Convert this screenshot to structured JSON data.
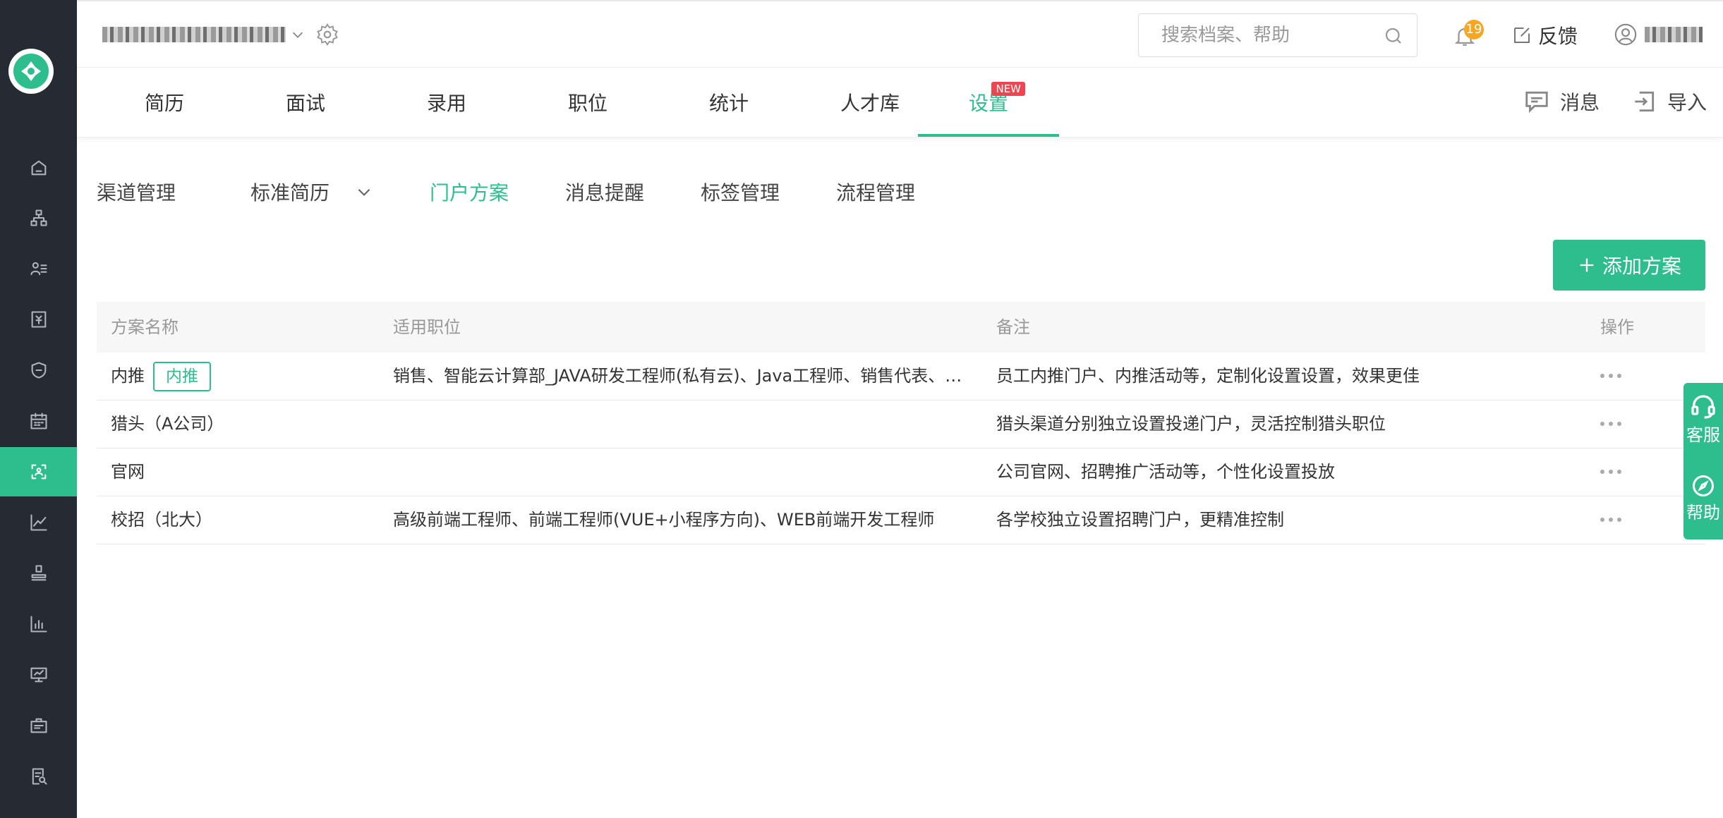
{
  "top": {
    "search_placeholder": "搜索档案、帮助",
    "notification_count": "19",
    "feedback": "反馈"
  },
  "tabs": [
    {
      "label": "简历"
    },
    {
      "label": "面试"
    },
    {
      "label": "录用"
    },
    {
      "label": "职位"
    },
    {
      "label": "统计"
    },
    {
      "label": "人才库"
    },
    {
      "label": "设置",
      "badge": "NEW",
      "active": true
    }
  ],
  "nav_right": {
    "messages": "消息",
    "import": "导入"
  },
  "subtabs": [
    {
      "label": "渠道管理"
    },
    {
      "label": "标准简历"
    },
    {
      "label": "门户方案",
      "active": true
    },
    {
      "label": "消息提醒"
    },
    {
      "label": "标签管理"
    },
    {
      "label": "流程管理"
    }
  ],
  "add_button": "添加方案",
  "table": {
    "headers": [
      "方案名称",
      "适用职位",
      "备注",
      "操作"
    ],
    "rows": [
      {
        "name": "内推",
        "tag": "内推",
        "positions": "销售、智能云计算部_JAVA研发工程师(私有云)、Java工程师、销售代表、…",
        "note": "员工内推门户、内推活动等，定制化设置设置，效果更佳"
      },
      {
        "name": "猎头（A公司）",
        "positions": "",
        "note": "猎头渠道分别独立设置投递门户，灵活控制猎头职位"
      },
      {
        "name": "官网",
        "positions": "",
        "note": "公司官网、招聘推广活动等，个性化设置投放"
      },
      {
        "name": "校招（北大）",
        "positions": "高级前端工程师、前端工程师(VUE+小程序方向)、WEB前端开发工程师",
        "note": "各学校独立设置招聘门户，更精准控制"
      }
    ]
  },
  "float": {
    "service": "客服",
    "help": "帮助"
  },
  "colors": {
    "accent": "#2ebd8c",
    "sidebar": "#262b33",
    "badge": "#f5a623",
    "new_badge": "#f0454f"
  },
  "sidebar_icons": [
    "home-icon",
    "org-icon",
    "candidates-icon",
    "salary-icon",
    "shield-icon",
    "calendar-icon",
    "portal-icon",
    "trend-icon",
    "stamp-icon",
    "bar-chart-icon",
    "board-icon",
    "briefcase-icon",
    "report-icon"
  ]
}
